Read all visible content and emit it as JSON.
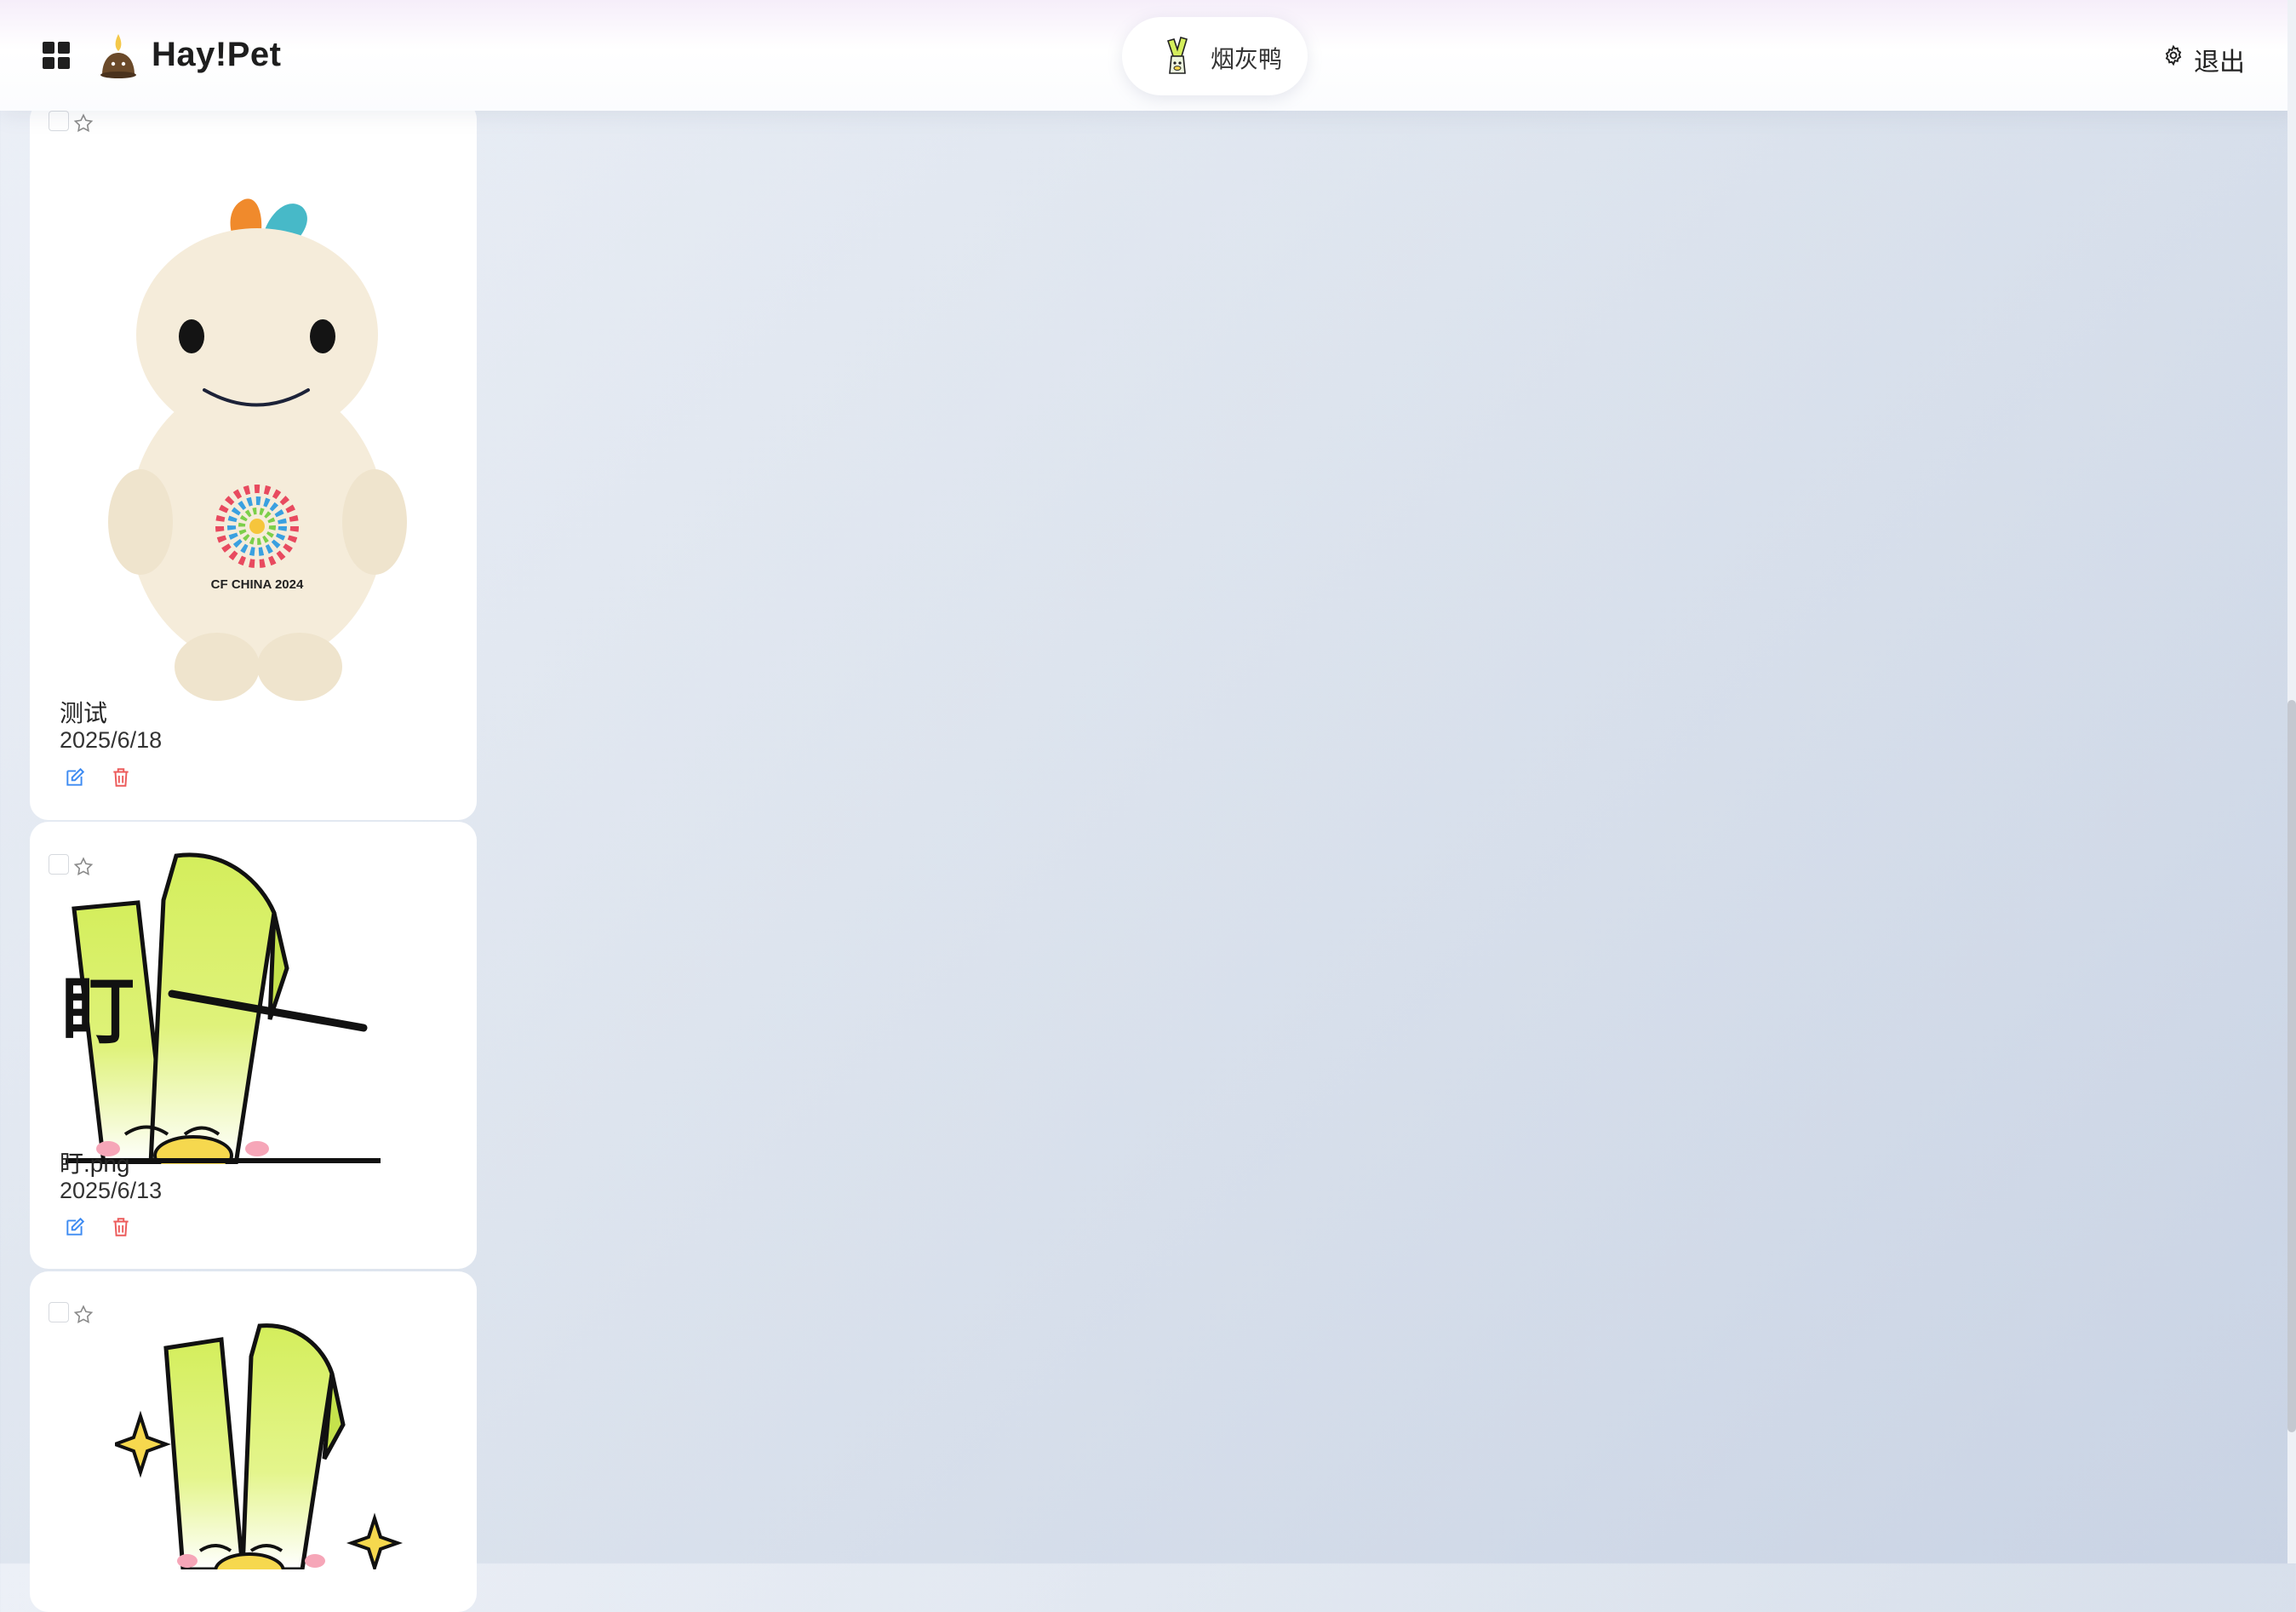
{
  "header": {
    "brand": "Hay!Pet",
    "user_name": "烟灰鸭",
    "logout_label": "退出"
  },
  "icons": {
    "apps": "apps-grid-icon",
    "logo": "leek-sprout-logo-icon",
    "settings": "gear-icon",
    "star": "star-outline-icon",
    "edit": "edit-icon",
    "delete": "trash-icon"
  },
  "colors": {
    "edit": "#3d8bf2",
    "delete": "#ec5b5b",
    "leek_green": "#d4ee5c"
  },
  "cards": [
    {
      "name": "测试",
      "date": "2025/6/18"
    },
    {
      "name": "盯.png",
      "date": "2025/6/13"
    },
    {
      "name": "",
      "date": ""
    }
  ]
}
